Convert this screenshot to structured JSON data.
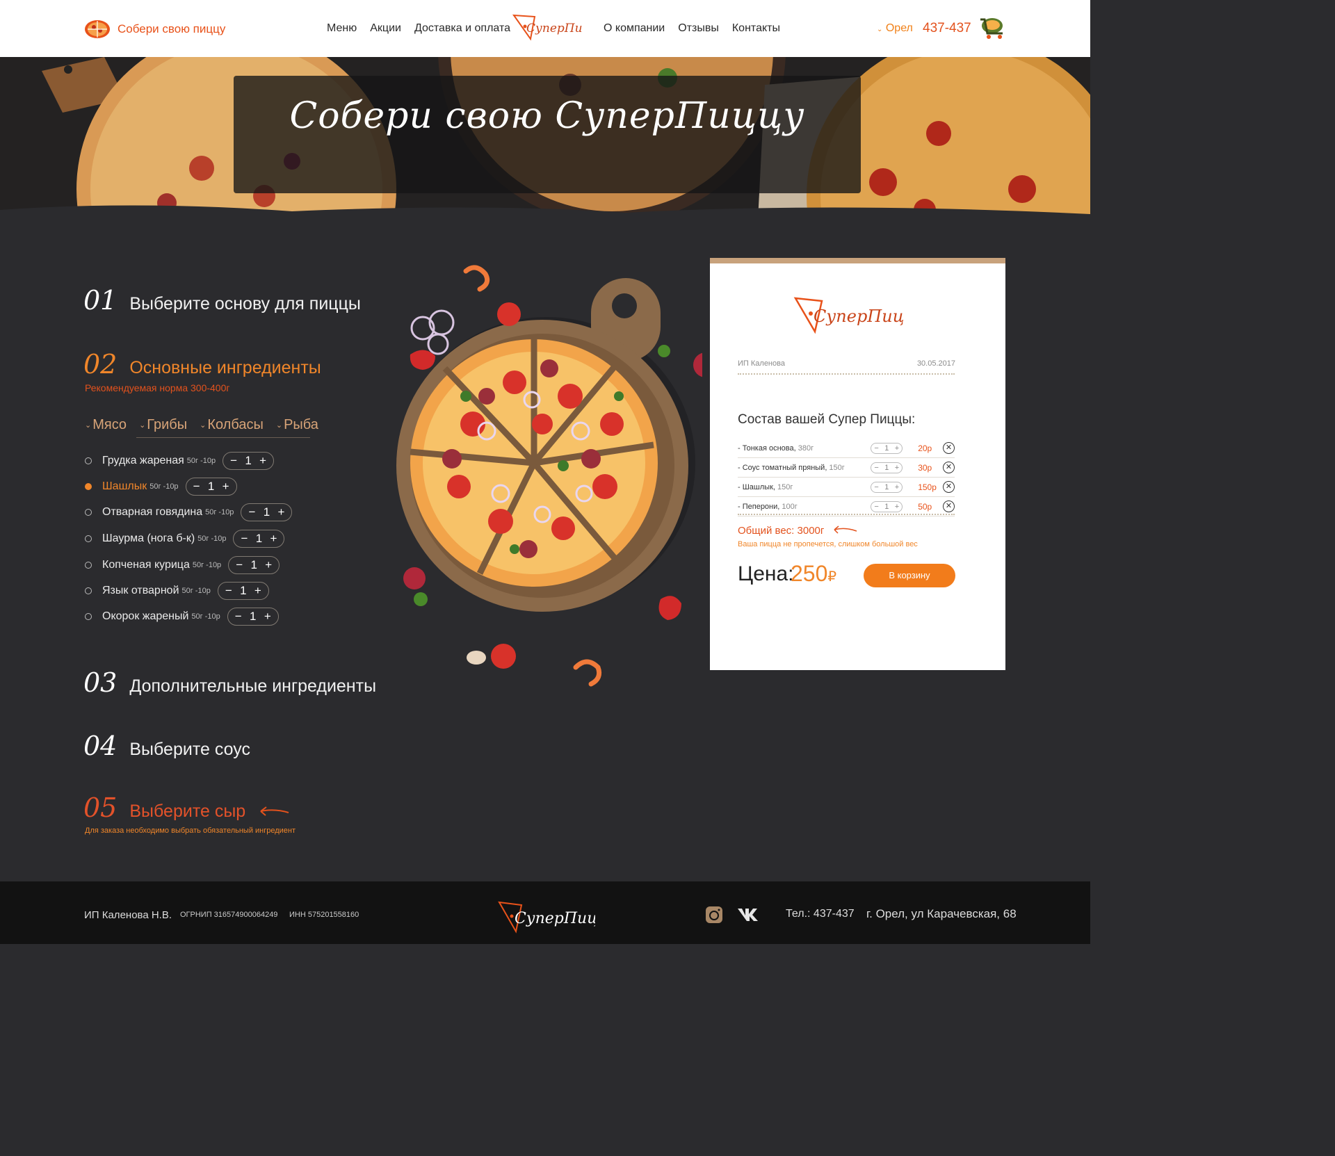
{
  "header": {
    "build_link": "Собери свою пиццу",
    "nav_left": [
      "Меню",
      "Акции",
      "Доставка и оплата"
    ],
    "logo_text": "СуперПицца",
    "nav_right": [
      "О компании",
      "Отзывы",
      "Контакты"
    ],
    "city": "Орел",
    "phone": "437-437"
  },
  "hero": {
    "title": "Собери свою СуперПиццу"
  },
  "steps": [
    {
      "num": "01",
      "label": "Выберите основу для пиццы"
    },
    {
      "num": "02",
      "label": "Основные ингредиенты",
      "note": "Рекомендуемая норма 300-400г"
    },
    {
      "num": "03",
      "label": "Дополнительные ингредиенты"
    },
    {
      "num": "04",
      "label": "Выберите соус"
    },
    {
      "num": "05",
      "label": "Выберите сыр",
      "note": "Для заказа необходимо выбрать обязательный ингредиент"
    }
  ],
  "tabs": [
    "Мясо",
    "Грибы",
    "Колбасы",
    "Рыба"
  ],
  "ingredients": [
    {
      "name": "Грудка жареная",
      "meta": "50г -10р",
      "qty": "1",
      "selected": false
    },
    {
      "name": "Шашлык",
      "meta": "50г -10р",
      "qty": "1",
      "selected": true
    },
    {
      "name": "Отварная говядина",
      "meta": "50г -10р",
      "qty": "1",
      "selected": false
    },
    {
      "name": "Шаурма (нога б-к)",
      "meta": "50г -10р",
      "qty": "1",
      "selected": false
    },
    {
      "name": "Копченая курица",
      "meta": "50г -10р",
      "qty": "1",
      "selected": false
    },
    {
      "name": "Язык отварной",
      "meta": "50г -10р",
      "qty": "1",
      "selected": false
    },
    {
      "name": "Окорок жареный",
      "meta": "50г -10р",
      "qty": "1",
      "selected": false
    }
  ],
  "receipt": {
    "logo_text": "СуперПицца",
    "owner": "ИП Каленова",
    "date": "30.05.2017",
    "title": "Состав вашей Супер Пиццы:",
    "rows": [
      {
        "name": "- Тонкая основа,",
        "weight": " 380г",
        "qty": "1",
        "price": "20р"
      },
      {
        "name": "- Соус томатный пряный,",
        "weight": " 150г",
        "qty": "1",
        "price": "30р"
      },
      {
        "name": "- Шашлык,",
        "weight": " 150г",
        "qty": "1",
        "price": "150р"
      },
      {
        "name": "- Пеперони,",
        "weight": " 100г",
        "qty": "1",
        "price": "50р"
      }
    ],
    "total_weight": "Общий вес: 3000г",
    "warning": "Ваша пицца не пропечется, слишком большой вес",
    "price_label": "Цена:",
    "price_value": "250",
    "currency": "₽",
    "cart_button": "В корзину"
  },
  "footer": {
    "owner": "ИП Каленова Н.В.",
    "ogrn": "ОГРНИП 316574900064249",
    "inn": "ИНН 575201558160",
    "logo_text": "СуперПицца",
    "tel": "Тел.: 437-437",
    "address": "г. Орел, ул Карачевская, 68"
  },
  "colors": {
    "accent": "#f0862a",
    "error": "#e3521d",
    "bg": "#2b2b2e",
    "wood": "#8b6a4a"
  },
  "icons": [
    "pizza-slice-icon",
    "chevron-down-icon",
    "cart-icon",
    "close-circle-icon",
    "instagram-icon",
    "vk-icon",
    "arrow-left-icon"
  ]
}
